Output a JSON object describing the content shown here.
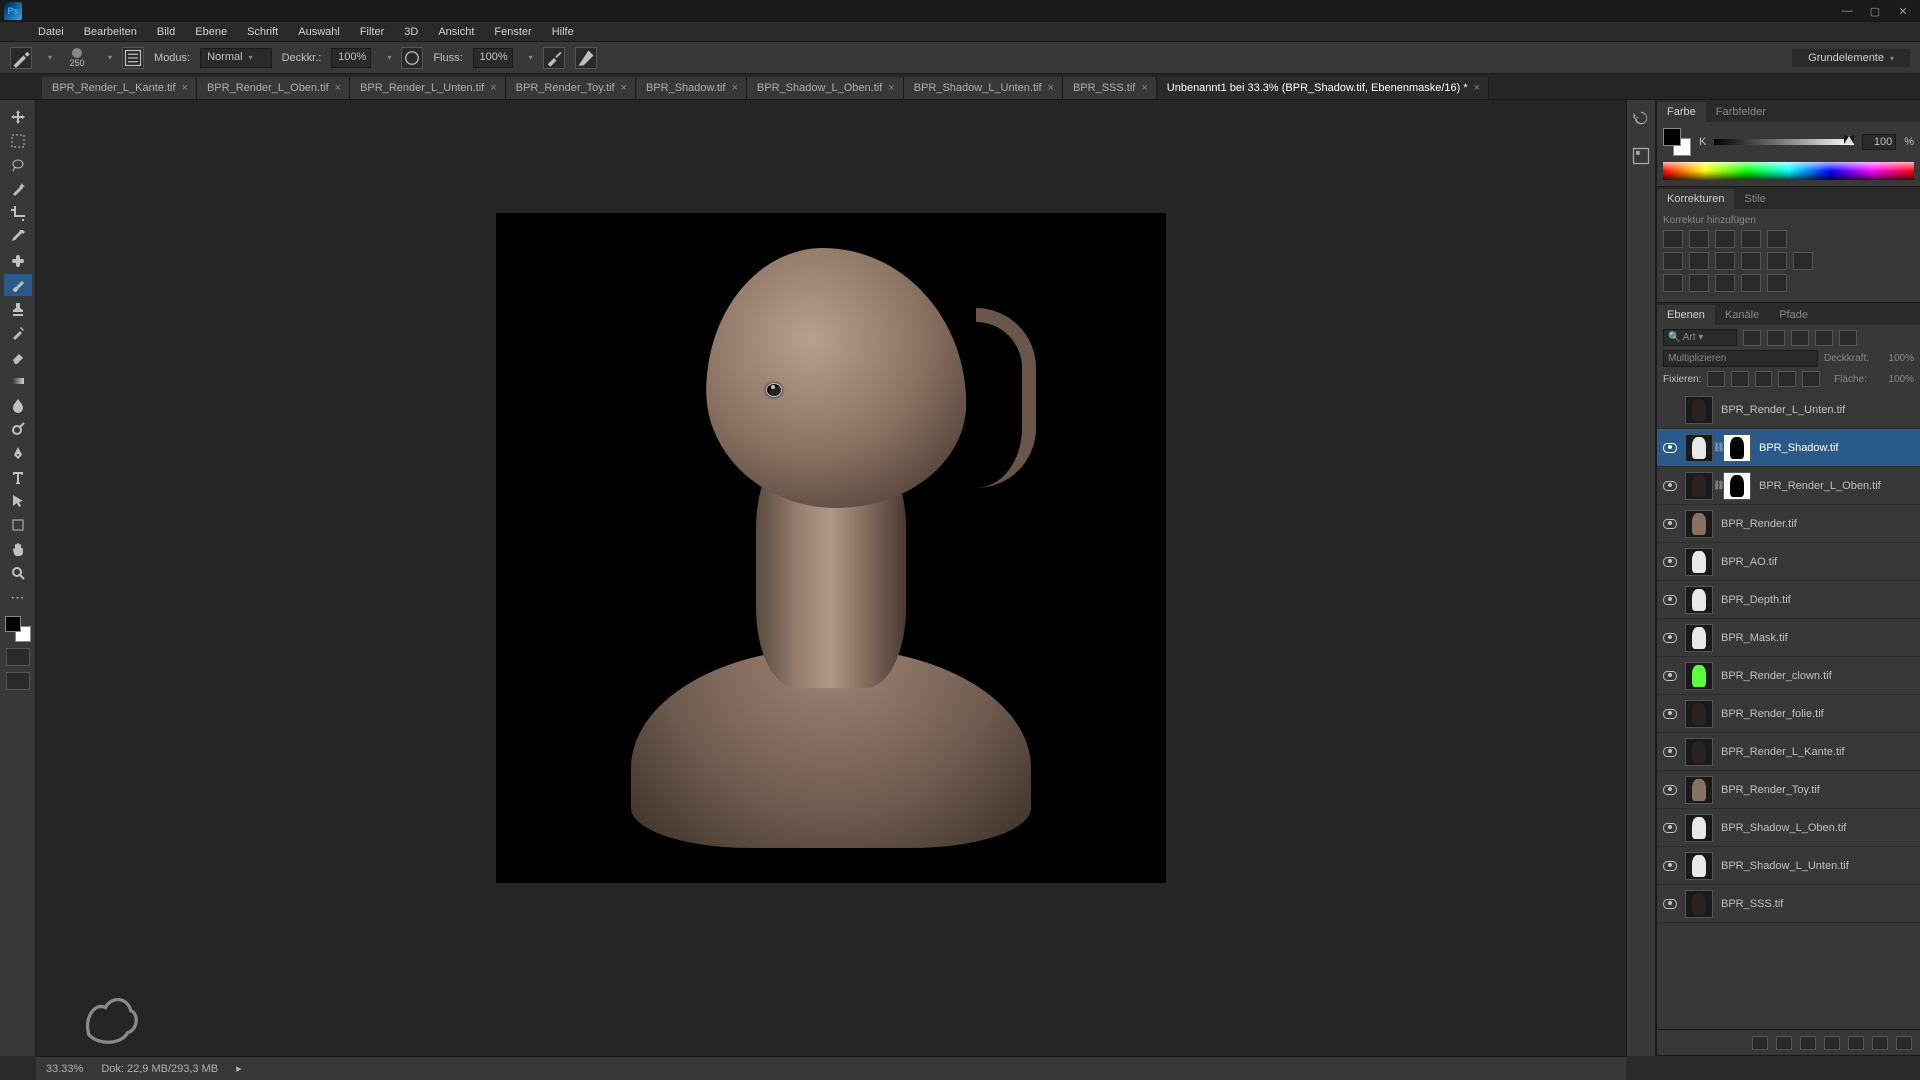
{
  "app": {
    "logo_text": "Ps"
  },
  "window_controls": {
    "min": "—",
    "max": "▢",
    "close": "✕"
  },
  "menu": [
    "Datei",
    "Bearbeiten",
    "Bild",
    "Ebene",
    "Schrift",
    "Auswahl",
    "Filter",
    "3D",
    "Ansicht",
    "Fenster",
    "Hilfe"
  ],
  "options": {
    "brush_size": "250",
    "mode_label": "Modus:",
    "mode_value": "Normal",
    "opacity_label": "Deckkr.:",
    "opacity_value": "100%",
    "flow_label": "Fluss:",
    "flow_value": "100%",
    "workspace": "Grundelemente"
  },
  "tabs": [
    {
      "label": "BPR_Render_L_Kante.tif",
      "active": false
    },
    {
      "label": "BPR_Render_L_Oben.tif",
      "active": false
    },
    {
      "label": "BPR_Render_L_Unten.tif",
      "active": false
    },
    {
      "label": "BPR_Render_Toy.tif",
      "active": false
    },
    {
      "label": "BPR_Shadow.tif",
      "active": false
    },
    {
      "label": "BPR_Shadow_L_Oben.tif",
      "active": false
    },
    {
      "label": "BPR_Shadow_L_Unten.tif",
      "active": false
    },
    {
      "label": "BPR_SSS.tif",
      "active": false
    },
    {
      "label": "Unbenannt1 bei 33.3% (BPR_Shadow.tif, Ebenenmaske/16) *",
      "active": true
    }
  ],
  "color_panel": {
    "tab1": "Farbe",
    "tab2": "Farbfelder",
    "channel": "K",
    "value": "100",
    "unit": "%"
  },
  "adjust_panel": {
    "tab1": "Korrekturen",
    "tab2": "Stile",
    "hint": "Korrektur hinzufügen"
  },
  "layers_panel": {
    "tab1": "Ebenen",
    "tab2": "Kanäle",
    "tab3": "Pfade",
    "filter_label": "Art",
    "blend_value": "Multiplizieren",
    "opacity_label": "Deckkraft:",
    "opacity_value": "100%",
    "lock_label": "Fixieren:",
    "fill_label": "Fläche:",
    "fill_value": "100%",
    "layers": [
      {
        "vis": false,
        "mask": false,
        "name": "BPR_Render_L_Unten.tif",
        "sel": false,
        "thumb": "dark"
      },
      {
        "vis": true,
        "mask": true,
        "name": "BPR_Shadow.tif",
        "sel": true,
        "thumb": "white"
      },
      {
        "vis": true,
        "mask": true,
        "name": "BPR_Render_L_Oben.tif",
        "sel": false,
        "thumb": "dark"
      },
      {
        "vis": true,
        "mask": false,
        "name": "BPR_Render.tif",
        "sel": false,
        "thumb": "normal"
      },
      {
        "vis": true,
        "mask": false,
        "name": "BPR_AO.tif",
        "sel": false,
        "thumb": "white"
      },
      {
        "vis": true,
        "mask": false,
        "name": "BPR_Depth.tif",
        "sel": false,
        "thumb": "white"
      },
      {
        "vis": true,
        "mask": false,
        "name": "BPR_Mask.tif",
        "sel": false,
        "thumb": "white"
      },
      {
        "vis": true,
        "mask": false,
        "name": "BPR_Render_clown.tif",
        "sel": false,
        "thumb": "green"
      },
      {
        "vis": true,
        "mask": false,
        "name": "BPR_Render_folie.tif",
        "sel": false,
        "thumb": "dark"
      },
      {
        "vis": true,
        "mask": false,
        "name": "BPR_Render_L_Kante.tif",
        "sel": false,
        "thumb": "dark"
      },
      {
        "vis": true,
        "mask": false,
        "name": "BPR_Render_Toy.tif",
        "sel": false,
        "thumb": "normal"
      },
      {
        "vis": true,
        "mask": false,
        "name": "BPR_Shadow_L_Oben.tif",
        "sel": false,
        "thumb": "white"
      },
      {
        "vis": true,
        "mask": false,
        "name": "BPR_Shadow_L_Unten.tif",
        "sel": false,
        "thumb": "white"
      },
      {
        "vis": true,
        "mask": false,
        "name": "BPR_SSS.tif",
        "sel": false,
        "thumb": "dark"
      }
    ]
  },
  "status": {
    "zoom": "33.33%",
    "doc": "Dok: 22,9 MB/293,3 MB"
  }
}
